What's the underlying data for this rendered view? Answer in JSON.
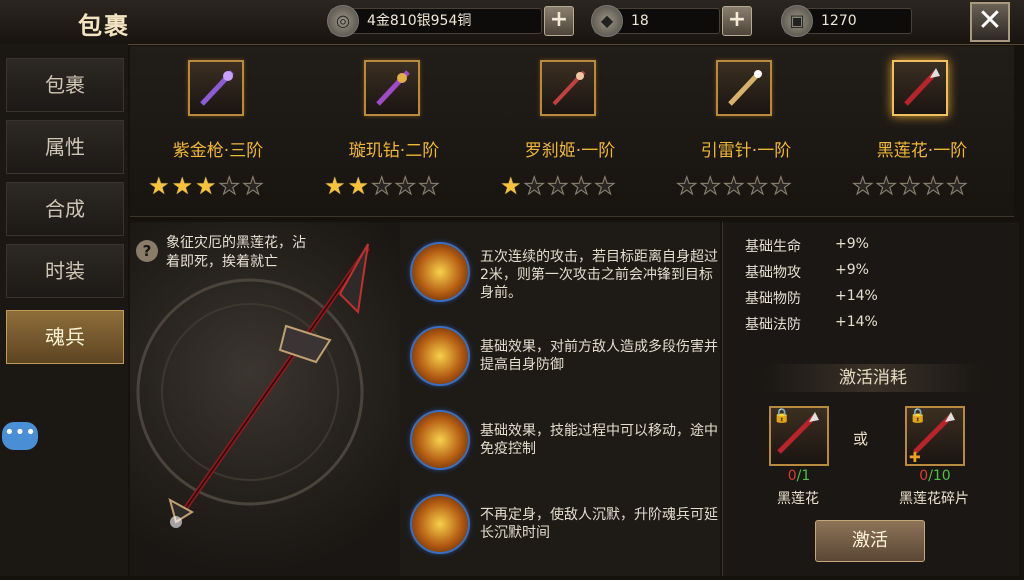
{
  "header": {
    "title": "包裹",
    "currency": "4金810银954铜",
    "diamonds": "18",
    "tickets": "1270"
  },
  "icons": {
    "coin": "coin-icon",
    "diamond": "diamond-icon",
    "ticket": "ticket-icon",
    "close": "close-icon",
    "help": "help-icon",
    "chat": "chat-icon",
    "lock": "lock-icon"
  },
  "sidebar": {
    "items": [
      {
        "label": "包裹"
      },
      {
        "label": "属性"
      },
      {
        "label": "合成"
      },
      {
        "label": "时装"
      },
      {
        "label": "魂兵"
      }
    ],
    "active": 4
  },
  "weapons": [
    {
      "name": "紫金枪·三阶",
      "stars": 3
    },
    {
      "name": "璇玑钻·二阶",
      "stars": 2
    },
    {
      "name": "罗刹姬·一阶",
      "stars": 1
    },
    {
      "name": "引雷针·一阶",
      "stars": 0
    },
    {
      "name": "黑莲花·一阶",
      "stars": 0
    }
  ],
  "selected_weapon": 4,
  "description": "象征灾厄的黑莲花，沾着即死，挨着就亡",
  "skills": [
    {
      "text": "五次连续的攻击，若目标距离自身超过2米，则第一次攻击之前会冲锋到目标身前。"
    },
    {
      "text": "基础效果，对前方敌人造成多段伤害并提高自身防御"
    },
    {
      "text": "基础效果，技能过程中可以移动，途中免疫控制"
    },
    {
      "text": "不再定身，使敌人沉默，升阶魂兵可延长沉默时间"
    }
  ],
  "stats": [
    {
      "label": "基础生命",
      "value": "+9%"
    },
    {
      "label": "基础物攻",
      "value": "+9%"
    },
    {
      "label": "基础物防",
      "value": "+14%"
    },
    {
      "label": "基础法防",
      "value": "+14%"
    }
  ],
  "cost": {
    "title": "激活消耗",
    "or": "或",
    "items": [
      {
        "name": "黑莲花",
        "have": "0",
        "need": "/1"
      },
      {
        "name": "黑莲花碎片",
        "have": "0",
        "need": "/10"
      }
    ],
    "button": "激活"
  }
}
